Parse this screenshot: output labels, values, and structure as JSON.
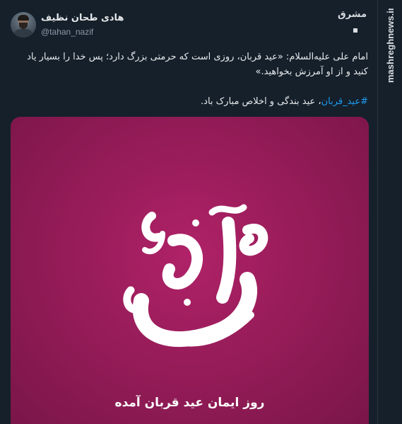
{
  "tweet": {
    "author_name": "هادی طحان نظیف",
    "author_handle": "@tahan_nazif",
    "paragraph1": "امام علی علیه‌السلام: «عید قربان، روزی است که حرمتی بزرگ دارد؛ پس خدا را بسیار یاد کنید و از او آمرزش بخواهید.»",
    "hashtag": "#عید_قربان",
    "paragraph2_rest": "، عید بندگی و اخلاص مبارک باد.",
    "image_caption": "روز ایمان عید قربان آمده",
    "image_calligraphy": "قربان"
  },
  "watermark": {
    "logo_text": "مشرق",
    "site": "mashreghnews.ir"
  },
  "colors": {
    "background": "#15202b",
    "text": "#e7e9ea",
    "secondary_text": "#8b98a5",
    "hashtag": "#1d9bf0",
    "image_bg": "#971c59"
  },
  "icons": [
    "avatar",
    "mashregh-logo"
  ]
}
